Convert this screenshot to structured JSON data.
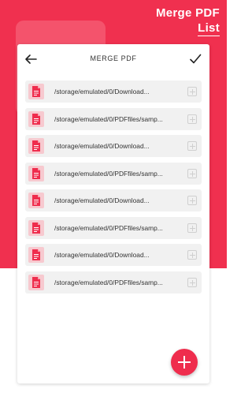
{
  "header": {
    "title_line1": "Merge PDF",
    "title_line2": "List"
  },
  "toolbar": {
    "title": "MERGE PDF",
    "back_icon": "arrow-left-icon",
    "confirm_icon": "check-icon"
  },
  "files": [
    {
      "path": "/storage/emulated/0/Download..."
    },
    {
      "path": "/storage/emulated/0/PDFfiles/samp..."
    },
    {
      "path": "/storage/emulated/0/Download..."
    },
    {
      "path": "/storage/emulated/0/PDFfiles/samp..."
    },
    {
      "path": "/storage/emulated/0/Download..."
    },
    {
      "path": "/storage/emulated/0/PDFfiles/samp..."
    },
    {
      "path": "/storage/emulated/0/Download..."
    },
    {
      "path": "/storage/emulated/0/PDFfiles/samp..."
    }
  ],
  "colors": {
    "accent": "#f0304f",
    "fab": "#ef2d4d",
    "file_icon_bg": "#f7c9cf",
    "row_bg": "#f1f1f1"
  },
  "fab_icon": "plus-icon"
}
